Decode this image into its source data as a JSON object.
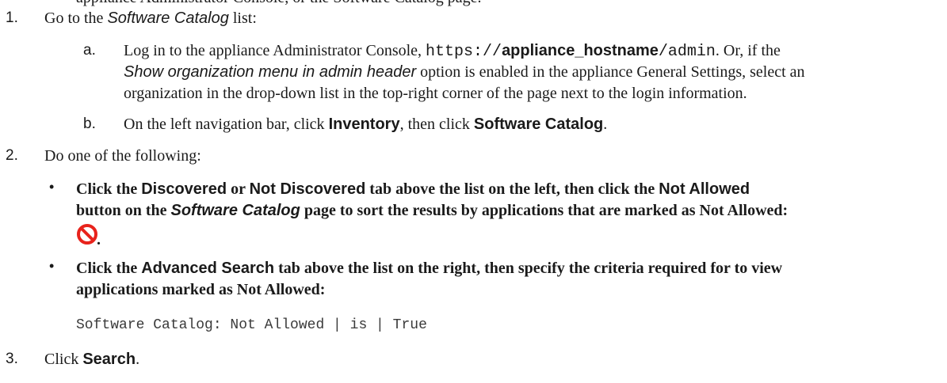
{
  "top_cut": {
    "text": "appliance Administrator Console, or the Software Catalog page."
  },
  "steps": {
    "s1": {
      "num": "1.",
      "pre": "Go to the ",
      "em": "Software Catalog",
      "post": " list:"
    },
    "s1a": {
      "letter": "a.",
      "l1_pre": "Log in to the appliance Administrator Console, ",
      "l1_code1": "https://",
      "l1_bold": "appliance_hostname",
      "l1_code2": "/admin",
      "l1_post": ". Or, if the",
      "l2_em": "Show organization menu in admin header",
      "l2_post": " option is enabled in the appliance General Settings, select an",
      "l3": "organization in the drop-down list in the top-right corner of the page next to the login information."
    },
    "s1b": {
      "letter": "b.",
      "pre": "On the left navigation bar, click ",
      "b1": "Inventory",
      "mid": ", then click ",
      "b2": "Software Catalog",
      "post": "."
    },
    "s2": {
      "num": "2.",
      "text": "Do one of the following:"
    },
    "bullet1": {
      "glyph": "•",
      "l1_pre": "Click the ",
      "l1_b1": "Discovered",
      "l1_mid1": " or ",
      "l1_b2": "Not Discovered",
      "l1_mid2": " tab above the list on the left, then click the ",
      "l1_b3": "Not Allowed",
      "l2_pre": "button on the ",
      "l2_em": "Software Catalog",
      "l2_post": " page to sort the results by applications that are marked as Not Allowed:",
      "l3_post": "."
    },
    "bullet2": {
      "glyph": "•",
      "l1_pre": "Click the ",
      "l1_b1": "Advanced Search",
      "l1_post": " tab above the list on the right, then specify the criteria required for to view",
      "l2": "applications marked as Not Allowed:",
      "code": "Software Catalog: Not Allowed | is | True"
    },
    "s3": {
      "num": "3.",
      "pre": "Click ",
      "b1": "Search",
      "post": "."
    }
  },
  "icons": {
    "not_allowed": "no-entry-icon",
    "not_allowed_color": "#e8231c"
  }
}
